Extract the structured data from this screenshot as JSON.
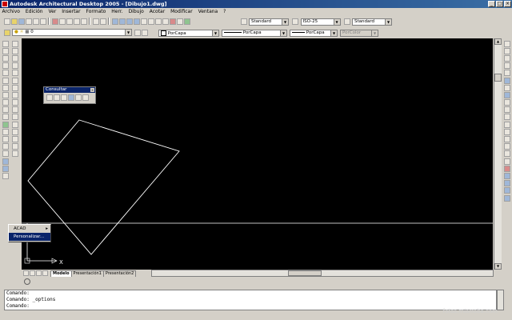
{
  "window": {
    "title": "Autodesk Architectural Desktop 2005 - [Dibujo1.dwg]"
  },
  "menu": [
    "Archivo",
    "Edición",
    "Ver",
    "Insertar",
    "Formato",
    "Herr.",
    "Dibujo",
    "Acotar",
    "Modificar",
    "Ventana",
    "?"
  ],
  "toolbar": {
    "text_style": "Standard",
    "dim_style": "ISO-25",
    "table_style": "Standard",
    "layer": "0",
    "color": "PorCapa",
    "linetype": "PorCapa",
    "lineweight": "PorCapa",
    "plotstyle": "PorColor"
  },
  "popup": {
    "title": "Consultar"
  },
  "context_menu": {
    "items": [
      "ACAD",
      "Personalizar..."
    ]
  },
  "tabs": [
    "Modelo",
    "Presentación1",
    "Presentación2"
  ],
  "command": {
    "lines": [
      "Comando:",
      "Comando: _options",
      "Comando:"
    ]
  },
  "watermark": "fotos.miarroba.com"
}
